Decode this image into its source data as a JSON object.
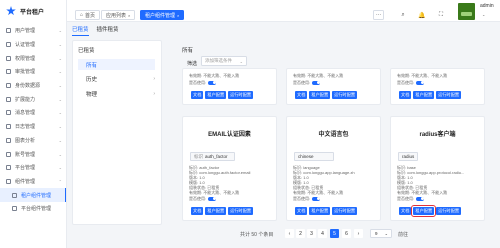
{
  "app": {
    "title": "平台租户"
  },
  "sidebar": {
    "items": [
      {
        "label": "用户管理",
        "chev": "⌄"
      },
      {
        "label": "认证管理",
        "chev": "⌄"
      },
      {
        "label": "权限管理",
        "chev": "⌄"
      },
      {
        "label": "审批管理",
        "chev": "⌄"
      },
      {
        "label": "身份数据源",
        "chev": "⌄"
      },
      {
        "label": "扩展能力",
        "chev": "⌄"
      },
      {
        "label": "消息管理",
        "chev": "⌄"
      },
      {
        "label": "日志管理",
        "chev": "⌄"
      },
      {
        "label": "图表分析",
        "chev": "⌄"
      },
      {
        "label": "账号管理",
        "chev": "⌄"
      },
      {
        "label": "平台管理",
        "chev": "⌄"
      },
      {
        "label": "组件管理",
        "chev": "⌃"
      },
      {
        "label": "租户组件管理",
        "chev": ""
      },
      {
        "label": "平台组件管理",
        "chev": ""
      }
    ]
  },
  "topbar": {
    "tabs": [
      {
        "label": "首页",
        "closable": ""
      },
      {
        "label": "应用列表",
        "closable": "×"
      },
      {
        "label": "租户组件管理",
        "closable": "×"
      }
    ],
    "more": "···",
    "icons": {
      "search": "⌕",
      "bell": "🔔",
      "expand": "⛶"
    },
    "user": {
      "name": "admin",
      "caret": "⌄"
    }
  },
  "subtabs": [
    "已租赁",
    "插件租赁"
  ],
  "categories": {
    "title": "已租赁",
    "items": [
      {
        "label": "所有",
        "chev": ""
      },
      {
        "label": "历史",
        "chev": "›"
      },
      {
        "label": "物理",
        "chev": "›"
      }
    ]
  },
  "main": {
    "title": "所有",
    "filter": {
      "label": "筛选",
      "placeholder": "添加筛选条件",
      "caret": "⌄"
    }
  },
  "cards_top": [
    {
      "l1": "有效期:  不能大跌、不能入跌",
      "l2": "是否使用:",
      "b1": "文档",
      "b2": "租户配置",
      "b3": "运行时配置"
    },
    {
      "l1": "有效期:  不能大跌、不能入跌",
      "l2": "是否使用:",
      "b1": "文档",
      "b2": "租户配置",
      "b3": "运行时配置"
    },
    {
      "l1": "有效期:  不能大跌、不能入跌",
      "l2": "是否使用:",
      "b1": "文档",
      "b2": "租户配置",
      "b3": "运行时配置"
    }
  ],
  "cards": [
    {
      "name": "EMAIL认证因素",
      "key_label": "标识",
      "key": "auth_factor",
      "box": "auth_factor",
      "lines": [
        "标识: auth_factor",
        "标识: com.longgu.auth.factor.email",
        "版本: 1.0",
        "模版: 1.0",
        "组装状态: 已租赁",
        "有效期:  不能大跌、不能入跌",
        "是否使用:"
      ],
      "b1": "文档",
      "b2": "租户配置",
      "b3": "运行时配置"
    },
    {
      "name": "中文语言包",
      "box": "chinese",
      "lines": [
        "标识: language",
        "标识: com.longgu.app.language.zh",
        "版本: 1.0",
        "模版: 1.0",
        "组装状态: 已租赁",
        "有效期:  不能大跌、不能入跌",
        "是否使用:"
      ],
      "b1": "文档",
      "b2": "租户配置",
      "b3": "运行时配置"
    },
    {
      "name": "radius客户端",
      "box": "radius",
      "lines": [
        "标识: base",
        "标识: com.longgu.app.protocol.radiu...",
        "版本: 1.0",
        "模版: 1.0",
        "组装状态: 已租赁",
        "有效期:  不能大跌、不能入跌",
        "是否使用:"
      ],
      "b1": "文档",
      "b2": "租户配置",
      "b3": "运行时配置"
    }
  ],
  "pagination": {
    "total": "共计 50 个条目",
    "prev": "‹",
    "pages": [
      "2",
      "3",
      "4",
      "5",
      "6"
    ],
    "active": "5",
    "next": "›",
    "size": "9",
    "size_caret": "⌄",
    "goto": "前往"
  }
}
